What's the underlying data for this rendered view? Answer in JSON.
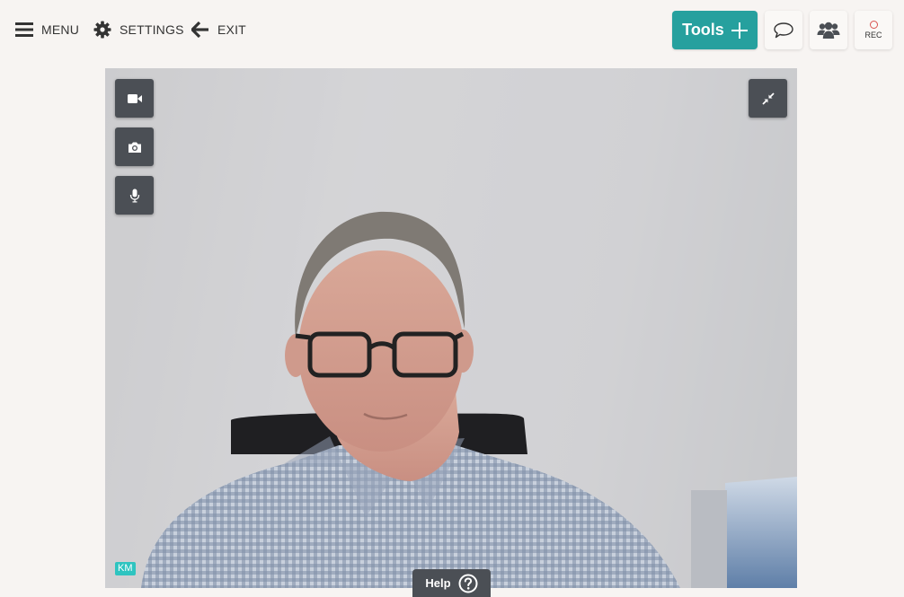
{
  "nav": {
    "menu_label": "MENU",
    "settings_label": "SETTINGS",
    "exit_label": "EXIT"
  },
  "toolbar": {
    "tools_label": "Tools",
    "rec_label": "REC"
  },
  "video": {
    "participant_initials": "KM"
  },
  "help": {
    "label": "Help"
  },
  "colors": {
    "accent": "#26a09e",
    "control_bg": "#4b4f55",
    "initials_badge": "#2ec4c0",
    "rec_dot": "#d9534f"
  },
  "icons": [
    "hamburger-icon",
    "gear-icon",
    "arrow-left-icon",
    "plus-icon",
    "chat-bubble-icon",
    "users-icon",
    "record-dot-icon",
    "video-camera-icon",
    "camera-icon",
    "microphone-icon",
    "minimize-icon",
    "question-circle-icon"
  ]
}
